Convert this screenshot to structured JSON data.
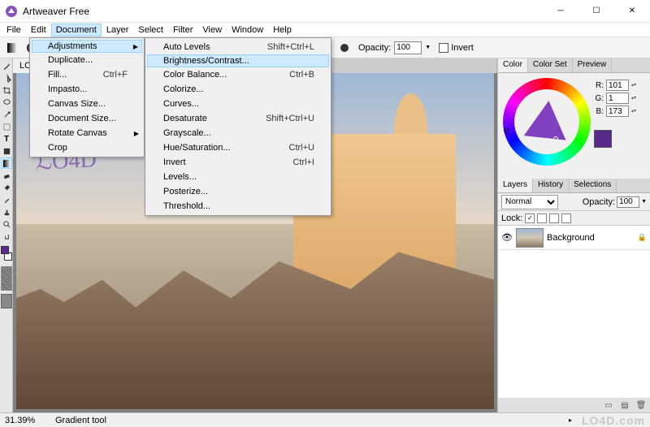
{
  "title": "Artweaver Free",
  "menubar": [
    "File",
    "Edit",
    "Document",
    "Layer",
    "Select",
    "Filter",
    "View",
    "Window",
    "Help"
  ],
  "menubar_open_index": 2,
  "toolbar": {
    "opacity_label": "Opacity:",
    "opacity_value": "100",
    "invert_label": "Invert"
  },
  "canvas": {
    "tab_label": "LO",
    "scribble": "ℒO4D"
  },
  "color_panel": {
    "tabs": [
      "Color",
      "Color Set",
      "Preview"
    ],
    "active_tab": 0,
    "rgb": {
      "R": "101",
      "G": "1",
      "B": "173"
    }
  },
  "layers_panel": {
    "tabs": [
      "Layers",
      "History",
      "Selections"
    ],
    "active_tab": 0,
    "blend_mode": "Normal",
    "opacity_label": "Opacity:",
    "opacity_value": "100",
    "lock_label": "Lock:",
    "layer_name": "Background"
  },
  "statusbar": {
    "zoom": "31.39%",
    "tool": "Gradient tool"
  },
  "watermark": "LO4D.com",
  "menu_document": [
    {
      "label": "Adjustments",
      "submenu": true,
      "hl": true
    },
    {
      "label": "Duplicate..."
    },
    {
      "label": "Fill...",
      "shortcut": "Ctrl+F"
    },
    {
      "label": "Impasto..."
    },
    {
      "label": "Canvas Size..."
    },
    {
      "label": "Document Size..."
    },
    {
      "label": "Rotate Canvas",
      "submenu": true
    },
    {
      "label": "Crop",
      "disabled": true
    }
  ],
  "menu_adjustments": [
    {
      "label": "Auto Levels",
      "shortcut": "Shift+Ctrl+L"
    },
    {
      "label": "Brightness/Contrast...",
      "hl": true
    },
    {
      "label": "Color Balance...",
      "shortcut": "Ctrl+B"
    },
    {
      "label": "Colorize..."
    },
    {
      "label": "Curves..."
    },
    {
      "label": "Desaturate",
      "shortcut": "Shift+Ctrl+U"
    },
    {
      "label": "Grayscale..."
    },
    {
      "label": "Hue/Saturation...",
      "shortcut": "Ctrl+U"
    },
    {
      "label": "Invert",
      "shortcut": "Ctrl+I"
    },
    {
      "label": "Levels..."
    },
    {
      "label": "Posterize..."
    },
    {
      "label": "Threshold..."
    }
  ]
}
